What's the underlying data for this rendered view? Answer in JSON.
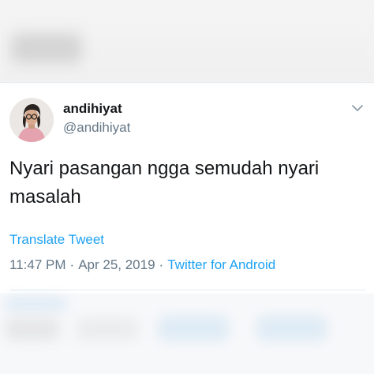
{
  "tweet": {
    "display_name": "andihiyat",
    "handle": "@andihiyat",
    "text": "Nyari pasangan ngga semudah nyari masalah",
    "translate_label": "Translate Tweet",
    "time": "11:47 PM",
    "date": "Apr 25, 2019",
    "separator": "·",
    "client": "Twitter for Android",
    "menu_icon": "chevron-down-icon"
  },
  "colors": {
    "link": "#1da1f2",
    "secondary_text": "#657786",
    "primary_text": "#14171a",
    "divider": "#e6ecf0"
  }
}
